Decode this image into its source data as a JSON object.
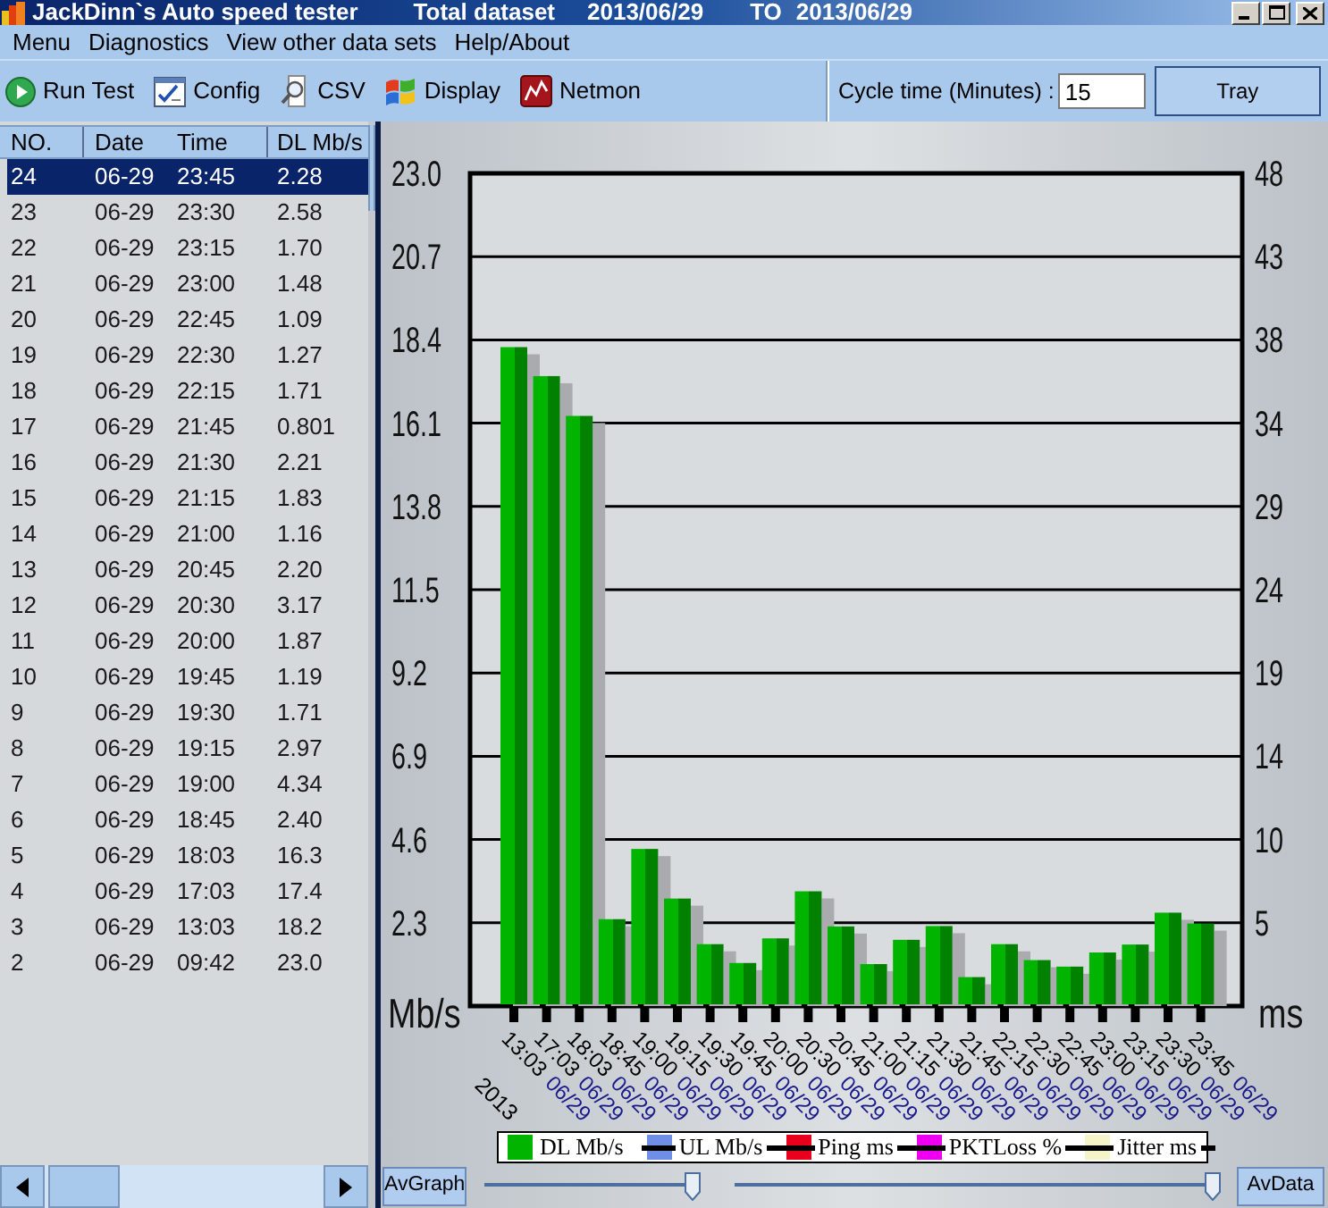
{
  "title_bar": {
    "title": "JackDinn`s Auto speed tester",
    "dataset": "Total dataset",
    "date_from": "2013/06/29",
    "to_label": "TO",
    "date_to": "2013/06/29"
  },
  "menu": [
    "Menu",
    "Diagnostics",
    "View other data sets",
    "Help/About"
  ],
  "toolbar": {
    "buttons": [
      {
        "kind": "run",
        "label": "Run Test"
      },
      {
        "kind": "config",
        "label": "Config"
      },
      {
        "kind": "csv",
        "label": "CSV"
      },
      {
        "kind": "display",
        "label": "Display"
      },
      {
        "kind": "netmon",
        "label": "Netmon"
      }
    ],
    "cycle_time": {
      "label": "Cycle time (Minutes) :",
      "value": "15"
    },
    "tray_button": "Tray"
  },
  "table": {
    "columns": [
      "NO.",
      "Date",
      "Time",
      "DL Mb/s"
    ],
    "rows": [
      {
        "cells": [
          "24",
          "06-29",
          "23:45",
          "2.28"
        ],
        "selected": true
      },
      {
        "cells": [
          "23",
          "06-29",
          "23:30",
          "2.58"
        ],
        "selected": false
      },
      {
        "cells": [
          "22",
          "06-29",
          "23:15",
          "1.70"
        ],
        "selected": false
      },
      {
        "cells": [
          "21",
          "06-29",
          "23:00",
          "1.48"
        ],
        "selected": false
      },
      {
        "cells": [
          "20",
          "06-29",
          "22:45",
          "1.09"
        ],
        "selected": false
      },
      {
        "cells": [
          "19",
          "06-29",
          "22:30",
          "1.27"
        ],
        "selected": false
      },
      {
        "cells": [
          "18",
          "06-29",
          "22:15",
          "1.71"
        ],
        "selected": false
      },
      {
        "cells": [
          "17",
          "06-29",
          "21:45",
          "0.801"
        ],
        "selected": false
      },
      {
        "cells": [
          "16",
          "06-29",
          "21:30",
          "2.21"
        ],
        "selected": false
      },
      {
        "cells": [
          "15",
          "06-29",
          "21:15",
          "1.83"
        ],
        "selected": false
      },
      {
        "cells": [
          "14",
          "06-29",
          "21:00",
          "1.16"
        ],
        "selected": false
      },
      {
        "cells": [
          "13",
          "06-29",
          "20:45",
          "2.20"
        ],
        "selected": false
      },
      {
        "cells": [
          "12",
          "06-29",
          "20:30",
          "3.17"
        ],
        "selected": false
      },
      {
        "cells": [
          "11",
          "06-29",
          "20:00",
          "1.87"
        ],
        "selected": false
      },
      {
        "cells": [
          "10",
          "06-29",
          "19:45",
          "1.19"
        ],
        "selected": false
      },
      {
        "cells": [
          "9",
          "06-29",
          "19:30",
          "1.71"
        ],
        "selected": false
      },
      {
        "cells": [
          "8",
          "06-29",
          "19:15",
          "2.97"
        ],
        "selected": false
      },
      {
        "cells": [
          "7",
          "06-29",
          "19:00",
          "4.34"
        ],
        "selected": false
      },
      {
        "cells": [
          "6",
          "06-29",
          "18:45",
          "2.40"
        ],
        "selected": false
      },
      {
        "cells": [
          "5",
          "06-29",
          "18:03",
          "16.3"
        ],
        "selected": false
      },
      {
        "cells": [
          "4",
          "06-29",
          "17:03",
          "17.4"
        ],
        "selected": false
      },
      {
        "cells": [
          "3",
          "06-29",
          "13:03",
          "18.2"
        ],
        "selected": false
      },
      {
        "cells": [
          "2",
          "06-29",
          "09:42",
          "23.0"
        ],
        "selected": false
      }
    ]
  },
  "chart": {
    "chart_data": {
      "type": "bar",
      "ylabel": "Mb/s",
      "categories": [
        "13:03",
        "17:03",
        "18:03",
        "18:45",
        "19:00",
        "19:15",
        "19:30",
        "19:45",
        "20:00",
        "20:30",
        "20:45",
        "21:00",
        "21:15",
        "21:30",
        "21:45",
        "22:15",
        "22:30",
        "22:45",
        "23:00",
        "23:15",
        "23:30",
        "23:45"
      ],
      "series": [
        {
          "name": "DL Mb/s",
          "color": "#00b400",
          "values": [
            18.2,
            17.4,
            16.3,
            2.4,
            4.34,
            2.97,
            1.71,
            1.19,
            1.87,
            3.17,
            2.2,
            1.16,
            1.83,
            2.21,
            0.8,
            1.71,
            1.27,
            1.09,
            1.48,
            1.7,
            2.58,
            2.28
          ]
        }
      ],
      "ylim": [
        0,
        23
      ],
      "yticks": [
        2.3,
        4.6,
        6.9,
        9.2,
        11.5,
        13.8,
        16.1,
        18.4,
        20.7,
        {
          "value": 23,
          "label": "23.0"
        }
      ],
      "grid": true
    },
    "category_dates": [
      "06/29",
      "06/29",
      "06/29",
      "06/29",
      "06/29",
      "06/29",
      "06/29",
      "06/29",
      "06/29",
      "06/29",
      "06/29",
      "06/29",
      "06/29",
      "06/29",
      "06/29",
      "06/29",
      "06/29",
      "06/29",
      "06/29",
      "06/29",
      "06/29",
      "06/29"
    ],
    "year_label": "2013",
    "right_axis": {
      "label": "ms",
      "ticks": [
        "48",
        "43",
        "38",
        "34",
        "29",
        "24",
        "19",
        "14",
        "10",
        "5"
      ]
    },
    "other_legend_items": [
      {
        "label": "UL Mb/s",
        "color": "#6f8fe6",
        "visible": false
      },
      {
        "label": "Ping ms",
        "color": "#e8001c",
        "visible": false
      },
      {
        "label": "PKTLoss %",
        "color": "#f000f0",
        "visible": false
      },
      {
        "label": "Jitter ms",
        "color": "#f5f3c8",
        "visible": false
      }
    ]
  },
  "bottom_bar": {
    "left_button": "AvGraph",
    "sliders": [
      {
        "level": 1
      },
      {
        "level": 1
      }
    ],
    "right_button": "AvData"
  }
}
